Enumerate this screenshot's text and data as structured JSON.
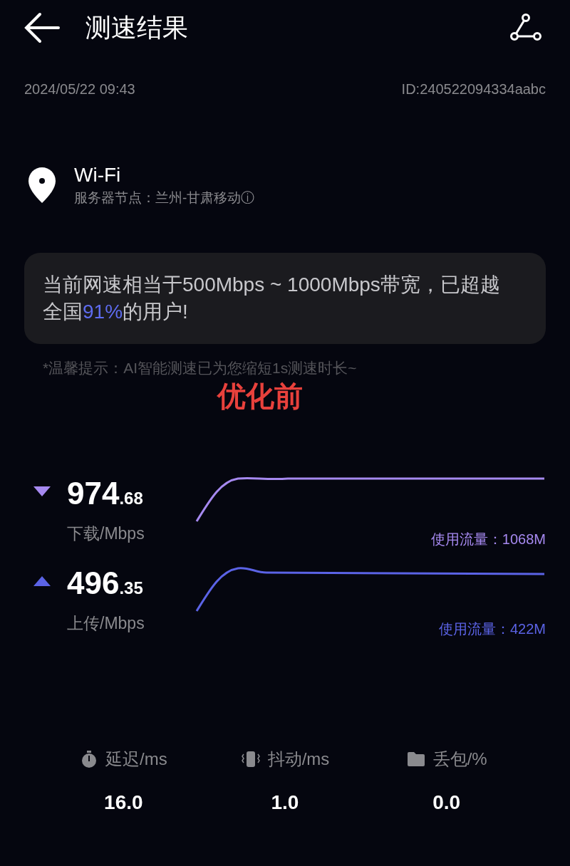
{
  "header": {
    "title": "测速结果"
  },
  "meta": {
    "time": "2024/05/22 09:43",
    "id": "ID:240522094334aabc"
  },
  "network": {
    "name": "Wi-Fi",
    "server": "服务器节点：兰州-甘肃移动",
    "info_mark": "ⓘ"
  },
  "summary": {
    "parts": [
      {
        "text": "当前网速相当于500Mbps ~ 1000Mbps带宽，已超越全国",
        "highlight": false
      },
      {
        "text": "91%",
        "highlight": true
      },
      {
        "text": "的用户!",
        "highlight": false
      }
    ]
  },
  "hint": "*温馨提示：AI智能测速已为您缩短1s测速时长~",
  "annotation": "优化前",
  "speeds": [
    {
      "kind": "download",
      "whole": "974",
      "fraction": ".68",
      "unit": "下载/Mbps",
      "usage": "使用流量：1068M",
      "color": "#a689f0"
    },
    {
      "kind": "upload",
      "whole": "496",
      "fraction": ".35",
      "unit": "上传/Mbps",
      "usage": "使用流量：422M",
      "color": "#5b63e6"
    }
  ],
  "stats": [
    {
      "kind": "latency",
      "label": "延迟/ms",
      "value": "16.0"
    },
    {
      "kind": "jitter",
      "label": "抖动/ms",
      "value": "1.0"
    },
    {
      "kind": "loss",
      "label": "丢包/%",
      "value": "0.0"
    }
  ]
}
